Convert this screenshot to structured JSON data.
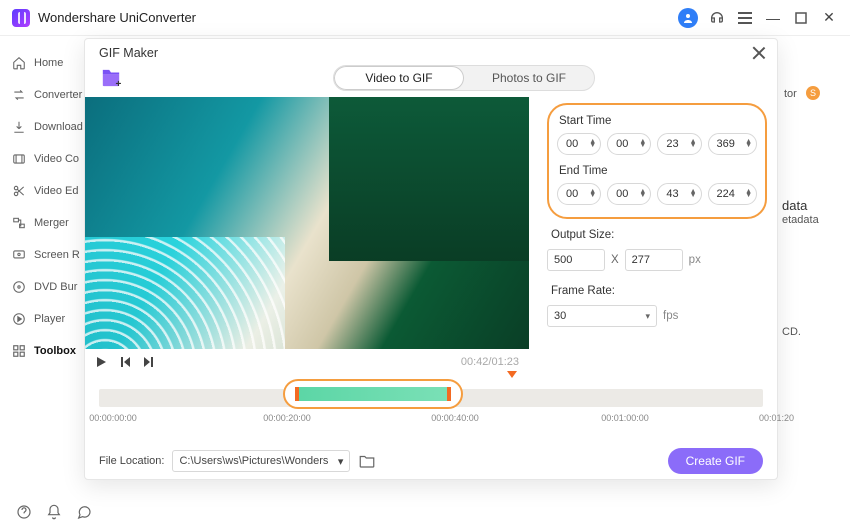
{
  "app": {
    "title": "Wondershare UniConverter"
  },
  "sidebar": {
    "items": [
      {
        "label": "Home"
      },
      {
        "label": "Converter"
      },
      {
        "label": "Download"
      },
      {
        "label": "Video Co"
      },
      {
        "label": "Video Ed"
      },
      {
        "label": "Merger"
      },
      {
        "label": "Screen R"
      },
      {
        "label": "DVD Bur"
      },
      {
        "label": "Player"
      },
      {
        "label": "Toolbox"
      }
    ]
  },
  "ghost": {
    "tor": "tor",
    "s": "S",
    "data": "data",
    "etadata": "etadata",
    "cd": "CD."
  },
  "modal": {
    "title": "GIF Maker",
    "tabs": {
      "video": "Video to GIF",
      "photos": "Photos to GIF"
    },
    "time": {
      "start_label": "Start Time",
      "end_label": "End Time",
      "start": {
        "h": "00",
        "m": "00",
        "s": "23",
        "ms": "369"
      },
      "end": {
        "h": "00",
        "m": "00",
        "s": "43",
        "ms": "224"
      }
    },
    "output": {
      "label": "Output Size:",
      "w": "500",
      "x": "X",
      "h": "277",
      "unit": "px"
    },
    "framerate": {
      "label": "Frame Rate:",
      "value": "30",
      "unit": "fps"
    },
    "playback": {
      "current": "00:42",
      "total": "01:23"
    },
    "timeline": {
      "labels": [
        "00:00:00:00",
        "00:00:20:00",
        "00:00:40:00",
        "00:01:00:00",
        "00:01:20"
      ]
    },
    "footer": {
      "label": "File Location:",
      "path": "C:\\Users\\ws\\Pictures\\Wonders",
      "button": "Create GIF"
    }
  }
}
